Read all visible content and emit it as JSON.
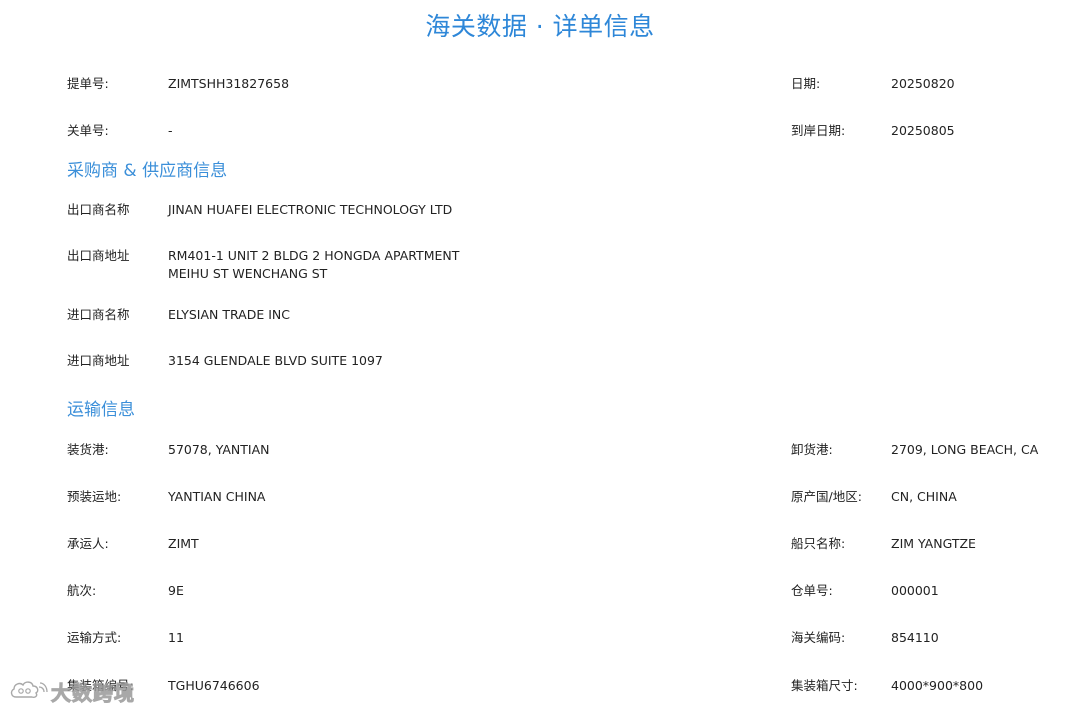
{
  "title": "海关数据 · 详单信息",
  "header": {
    "bill_no_label": "提单号:",
    "bill_no_value": "ZIMTSHH31827658",
    "date_label": "日期:",
    "date_value": "20250820",
    "master_no_label": "关单号:",
    "master_no_value": "-",
    "arrival_date_label": "到岸日期:",
    "arrival_date_value": "20250805"
  },
  "parties": {
    "section_title": "采购商 & 供应商信息",
    "exporter_name_label": "出口商名称",
    "exporter_name_value": "JINAN HUAFEI ELECTRONIC TECHNOLOGY LTD",
    "exporter_address_label": "出口商地址",
    "exporter_address_line1": "RM401-1 UNIT 2 BLDG 2 HONGDA APARTMENT",
    "exporter_address_line2": "MEIHU ST WENCHANG ST",
    "importer_name_label": "进口商名称",
    "importer_name_value": "ELYSIAN TRADE INC",
    "importer_address_label": "进口商地址",
    "importer_address_value": "3154 GLENDALE BLVD SUITE 1097"
  },
  "transport": {
    "section_title": "运输信息",
    "rows": [
      {
        "left_label": "装货港:",
        "left_value": "57078, YANTIAN",
        "right_label": "卸货港:",
        "right_value": "2709, LONG BEACH, CA"
      },
      {
        "left_label": "预装运地:",
        "left_value": "YANTIAN CHINA",
        "right_label": "原产国/地区:",
        "right_value": "CN, CHINA"
      },
      {
        "left_label": "承运人:",
        "left_value": "ZIMT",
        "right_label": "船只名称:",
        "right_value": "ZIM YANGTZE"
      },
      {
        "left_label": "航次:",
        "left_value": "9E",
        "right_label": "仓单号:",
        "right_value": "000001"
      },
      {
        "left_label": "运输方式:",
        "left_value": "11",
        "right_label": "海关编码:",
        "right_value": "854110"
      },
      {
        "left_label": "集装箱编号:",
        "left_value": "TGHU6746606",
        "right_label": "集装箱尺寸:",
        "right_value": "4000*900*800"
      }
    ]
  },
  "watermark": {
    "text": "大数跨境",
    "icon": "weibo-cloud-logo"
  },
  "colors": {
    "accent": "#2e87d8",
    "section": "#3b8fd9",
    "text": "#222222",
    "background": "#ffffff"
  }
}
